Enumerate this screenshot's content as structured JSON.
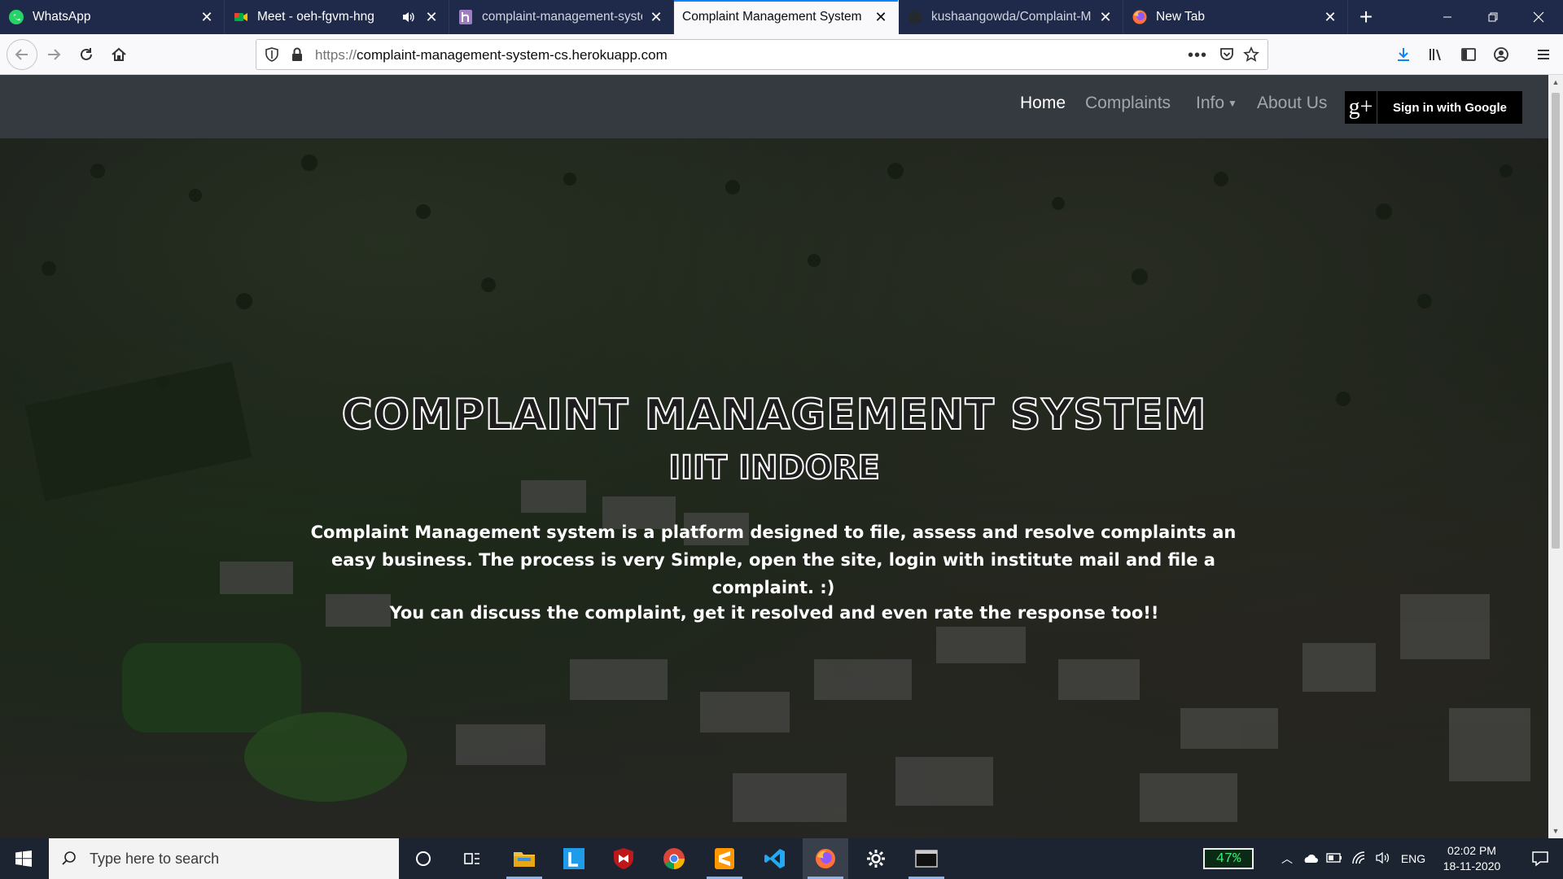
{
  "browser": {
    "tabs": [
      {
        "title": "WhatsApp",
        "icon": "whatsapp-icon",
        "active": false
      },
      {
        "title": "Meet - oeh-fgvm-hng",
        "icon": "google-meet-icon",
        "active": false,
        "audio": true
      },
      {
        "title": "complaint-management-syste",
        "icon": "heroku-icon",
        "active": false
      },
      {
        "title": "Complaint Management System",
        "icon": "",
        "active": true
      },
      {
        "title": "kushaangowda/Complaint-Ma",
        "icon": "github-icon",
        "active": false
      },
      {
        "title": "New Tab",
        "icon": "firefox-icon",
        "active": false
      }
    ],
    "url_scheme": "https://",
    "url_host": "complaint-management-system-cs.herokuapp.com"
  },
  "site": {
    "nav": {
      "home": "Home",
      "complaints": "Complaints",
      "info": "Info",
      "about": "About Us",
      "google_icon": "g+",
      "google_signin": "Sign in with Google"
    },
    "hero": {
      "title": "Complaint Management System",
      "subtitle": "IIIT Indore",
      "description": "Complaint Management system is a platform designed to file, assess and resolve complaints an easy business. The process is very Simple, open the site, login with institute mail and file a complaint. :)",
      "description2": "You can discuss the complaint, get it resolved and even rate the response too!!"
    }
  },
  "taskbar": {
    "search_placeholder": "Type here to search",
    "battery": "47%",
    "language": "ENG",
    "time": "02:02 PM",
    "date": "18-11-2020"
  },
  "colors": {
    "tabstrip": "#1f2a4a",
    "site_nav": "#343a40",
    "accent": "#0a84ff",
    "taskbar": "#1c2432"
  }
}
